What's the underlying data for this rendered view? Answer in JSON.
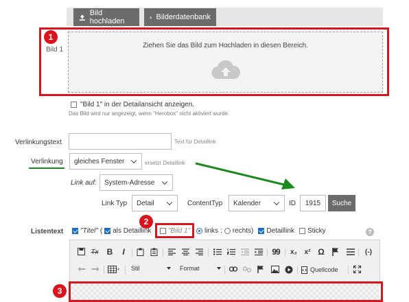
{
  "upload": {
    "upload_button": "Bild hochladen",
    "database_button": "Bilderdatenbank",
    "row_label": "Bild 1",
    "dropzone_text": "Ziehen Sie das Bild zum Hochladen in diesen Bereich.",
    "detail_checkbox_label": "\"Bild 1\" in der Detailansicht anzeigen.",
    "detail_note": "Das Bild wird nur angezeigt, wenn \"Herobox\" nicht aktiviert wurde."
  },
  "badges": [
    "1",
    "2",
    "3"
  ],
  "link": {
    "text_label": "Verlinkungstext",
    "text_value": "",
    "text_hint": "Text für Detaillink",
    "link_label": "Verlinkung",
    "link_select": "gleiches Fenster",
    "link_hint": "ersetzt Detaillink",
    "link_on_label": "Link auf:",
    "link_on_select": "System-Adresse",
    "link_type_label": "Link Typ",
    "link_type_select": "Detail",
    "content_type_label": "ContentTyp",
    "content_type_select": "Kalender",
    "id_label": "ID",
    "id_value": "1915",
    "search_button": "Suche"
  },
  "list": {
    "label": "Listentext",
    "opt_title": "\"Titel\"",
    "opt_title_sep": "(",
    "opt_detaillink": "als Detaillink",
    "opt_bild": "\"Bild 1\"",
    "opt_links": "links",
    "opt_colon": ":",
    "opt_rechts": "rechts)",
    "opt_detaillink2": "Detaillink",
    "opt_sticky": "Sticky",
    "help": "?"
  },
  "editor": {
    "style_select": "Stil",
    "format_select": "Format",
    "source_label": "Quellcode",
    "glyph_bold": "B",
    "glyph_clear": "Tx",
    "glyph_italic": "I",
    "glyph_quote": "99",
    "glyph_sub": "x₂",
    "glyph_sup": "x²",
    "glyph_omega": "Ω",
    "glyph_placeholder": "(-)"
  },
  "colors": {
    "red": "#d9141d",
    "green": "#1a8a1a",
    "button": "#6b6b6b",
    "blue": "#1a6fc4"
  }
}
